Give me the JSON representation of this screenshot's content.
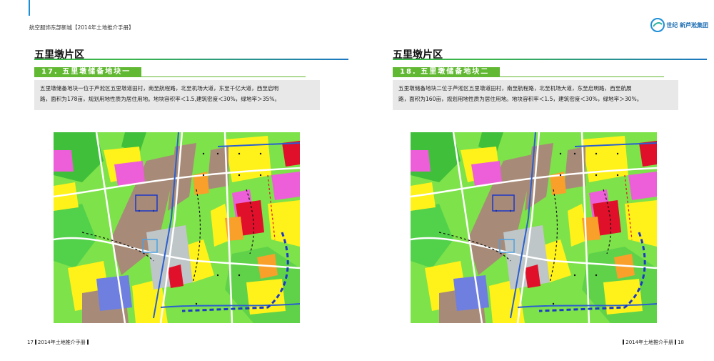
{
  "header": {
    "left_text": "航空服饰东部新城【2014年土地推介手册】",
    "logo_text": "世纪 新芦淞集团"
  },
  "pages": [
    {
      "section_title": "五里墩片区",
      "sub_title": "17. 五里墩储备地块一",
      "desc_lines": [
        "五里墩储备地块一位于芦淞区五里墩道田村，南至航程路，北至机场大道，东至千亿大道，西至启明",
        "路，面积为178亩，规划用地性质为居住用地。地块容积率＜1.5,建筑密度＜30%，绿地率＞35%。"
      ],
      "footer_page": "17",
      "footer_text": "2014年土地推介手册"
    },
    {
      "section_title": "五里墩片区",
      "sub_title": "18. 五里墩储备地块二",
      "desc_lines": [
        "五里墩储备地块二位于芦淞区五里墩道田村，南至航程路，北至机场大道，东至启明路，西至航展",
        "路，面积为160亩，规划用地性质为居住用地。地块容积率＜1.5，建筑密度＜30%，绿地率＞30%。"
      ],
      "footer_page": "18",
      "footer_text": "2014年土地推介手册"
    }
  ],
  "colors": {
    "green_banner": "#61b832",
    "blue_accent": "#1c77c3",
    "map_green": "#7ee24a",
    "map_dark_green": "#3fbf3a",
    "map_yellow": "#fff21a",
    "map_brown": "#a88a78",
    "map_pink": "#ec5fd8",
    "map_red": "#e0102a",
    "map_orange": "#f8a02a",
    "map_blue": "#6f7fe0",
    "map_gray": "#bfc6c8"
  }
}
